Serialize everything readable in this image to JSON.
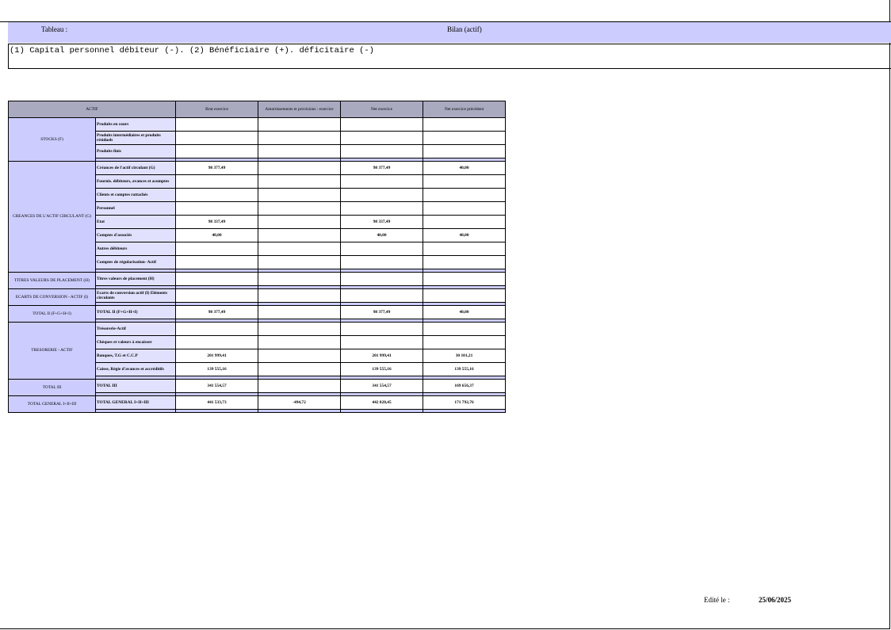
{
  "header": {
    "tableau_label": "Tableau :",
    "title": "Bilan (actif)",
    "note": "(1) Capital personnel débiteur (-). (2) Bénéficiaire (+). déficitaire (-)"
  },
  "table": {
    "columns": [
      "ACTIF",
      "Brut exercice",
      "Amortissements et provisions : exercice",
      "Net exercice",
      "Net exercice précédent"
    ],
    "stocks": {
      "category": "STOCKS (F)",
      "rows": [
        {
          "label": "Produits en cours",
          "brut": "",
          "amort": "",
          "net": "",
          "prec": ""
        },
        {
          "label": "Produits intermédiaires et produits résiduels",
          "brut": "",
          "amort": "",
          "net": "",
          "prec": ""
        },
        {
          "label": "Produits finis",
          "brut": "",
          "amort": "",
          "net": "",
          "prec": ""
        }
      ]
    },
    "creances": {
      "category": "CREANCES DE L'ACTIF CIRCULANT (G)",
      "rows": [
        {
          "label": "Créances de l'actif circulant (G)",
          "brut": "98 377,49",
          "amort": "",
          "net": "98 377,49",
          "prec": "40,00"
        },
        {
          "label": "Fournis. débiteurs, avances et acomptes",
          "brut": "",
          "amort": "",
          "net": "",
          "prec": ""
        },
        {
          "label": "Clients et comptes rattachés",
          "brut": "",
          "amort": "",
          "net": "",
          "prec": ""
        },
        {
          "label": "Personnel",
          "brut": "",
          "amort": "",
          "net": "",
          "prec": ""
        },
        {
          "label": "Etat",
          "brut": "98 337,49",
          "amort": "",
          "net": "98 337,49",
          "prec": ""
        },
        {
          "label": "Comptes d'associés",
          "brut": "40,00",
          "amort": "",
          "net": "40,00",
          "prec": "40,00"
        },
        {
          "label": "Autres débiteurs",
          "brut": "",
          "amort": "",
          "net": "",
          "prec": ""
        },
        {
          "label": "Comptes de régularisation- Actif",
          "brut": "",
          "amort": "",
          "net": "",
          "prec": ""
        }
      ]
    },
    "titres": {
      "category": "TITRES VALEURS DE PLACEMENT (H)",
      "rows": [
        {
          "label": "Titres valeurs de placement (H)",
          "brut": "",
          "amort": "",
          "net": "",
          "prec": ""
        }
      ]
    },
    "ecarts": {
      "category": "ECARTS DE CONVERSION - ACTIF (I)",
      "rows": [
        {
          "label": "Ecarts de conversion actif (I) Eléments circulants",
          "brut": "",
          "amort": "",
          "net": "",
          "prec": ""
        }
      ]
    },
    "total2": {
      "category": "TOTAL II (F+G+H+I)",
      "rows": [
        {
          "label": "TOTAL II (F+G+H+I)",
          "brut": "98 377,49",
          "amort": "",
          "net": "98 377,49",
          "prec": "40,00"
        }
      ]
    },
    "tresorerie": {
      "category": "TRESORERIE - ACTIF",
      "rows": [
        {
          "label": "Trésorerie-Actif",
          "brut": "",
          "amort": "",
          "net": "",
          "prec": ""
        },
        {
          "label": "Chèques et valeurs à encaisser",
          "brut": "",
          "amort": "",
          "net": "",
          "prec": ""
        },
        {
          "label": "Banques, T.G et C.C.P",
          "brut": "201 999,41",
          "amort": "",
          "net": "201 999,41",
          "prec": "30 101,21"
        },
        {
          "label": "Caisse, Régie d'avances et accréditifs",
          "brut": "139 555,16",
          "amort": "",
          "net": "139 555,16",
          "prec": "139 555,16"
        }
      ]
    },
    "total3": {
      "category": "TOTAL III",
      "rows": [
        {
          "label": "TOTAL III",
          "brut": "341 554,57",
          "amort": "",
          "net": "341 554,57",
          "prec": "169 656,37"
        }
      ]
    },
    "totalgen": {
      "category": "TOTAL GENERAL I+II+III",
      "rows": [
        {
          "label": "TOTAL GENERAL I+II+III",
          "brut": "441 533,73",
          "amort": "-494,72",
          "net": "442 028,45",
          "prec": "171 792,76"
        }
      ]
    }
  },
  "footer": {
    "edite_label": "Edité le :",
    "edite_date": "25/06/2025"
  }
}
